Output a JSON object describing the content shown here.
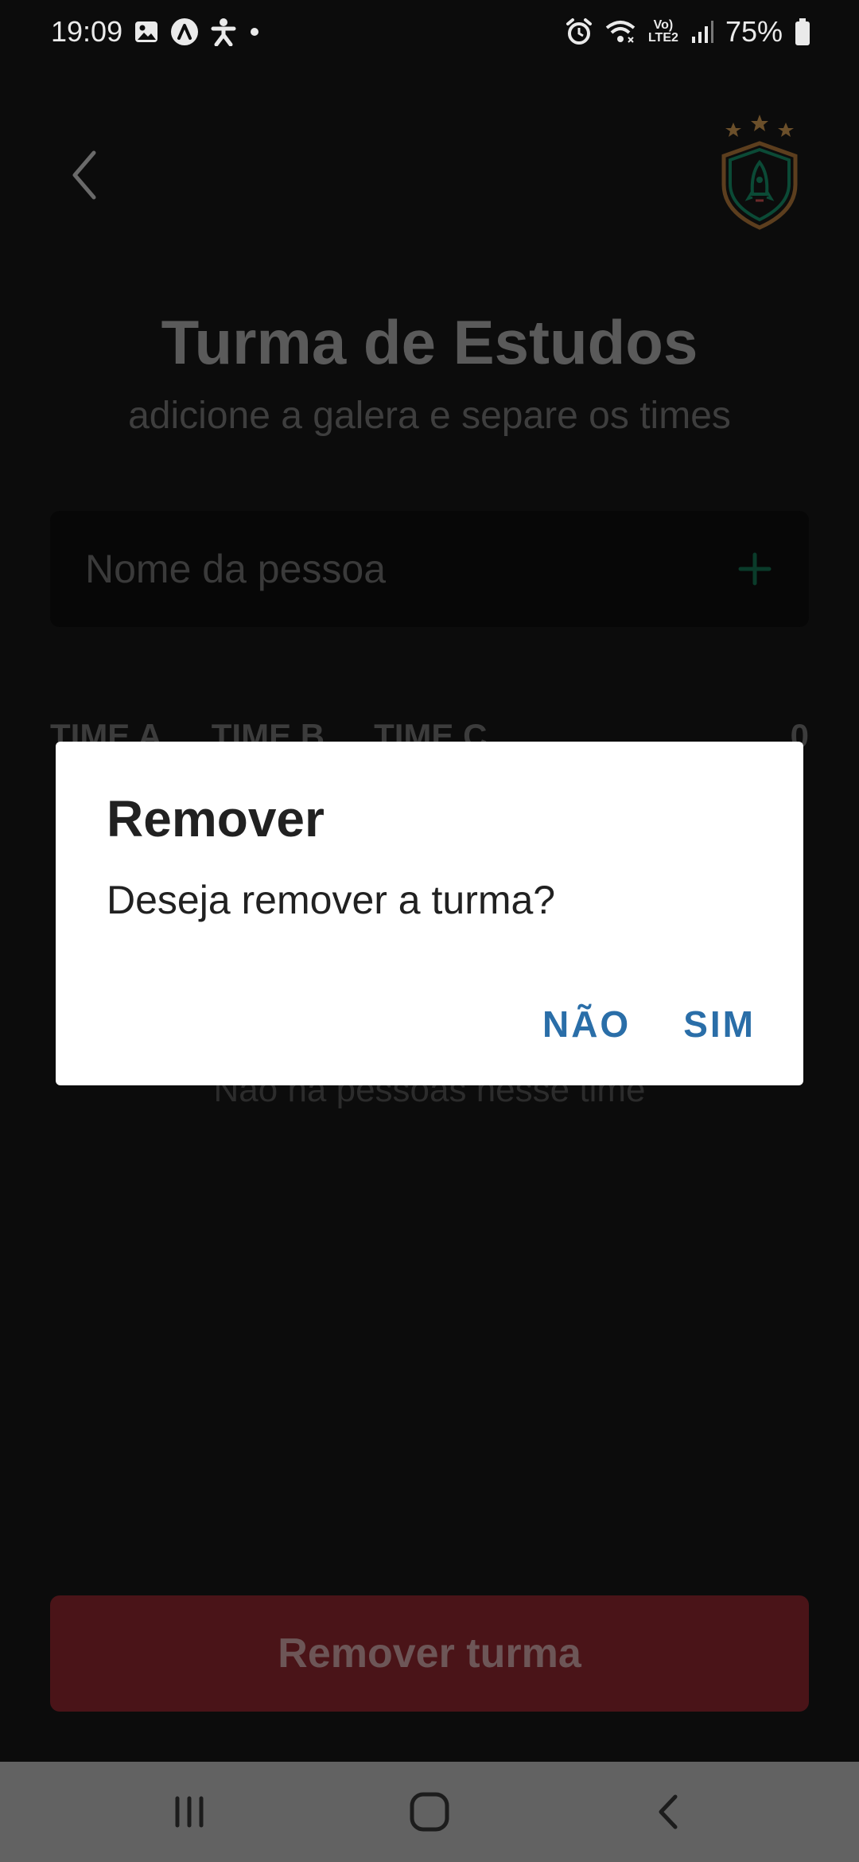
{
  "status_bar": {
    "time": "19:09",
    "network_label": "Vo) LTE2",
    "battery": "75%"
  },
  "header": {
    "title": "Turma de Estudos",
    "subtitle": "adicione a galera e separe os times"
  },
  "input": {
    "placeholder": "Nome da pessoa"
  },
  "tabs": {
    "items": [
      "TIME A",
      "TIME B",
      "TIME C"
    ],
    "count": "0"
  },
  "empty_state": "Não há pessoas nesse time",
  "remove_button_label": "Remover turma",
  "dialog": {
    "title": "Remover",
    "message": "Deseja remover a turma?",
    "cancel_label": "NÃO",
    "confirm_label": "SIM"
  },
  "colors": {
    "background": "#0c0c0c",
    "accent_green": "#00875f",
    "danger": "#4a1418",
    "dialog_button": "#2a6ea8"
  },
  "icons": {
    "back": "chevron-left-icon",
    "logo": "rocket-shield-logo",
    "add": "plus-icon"
  }
}
